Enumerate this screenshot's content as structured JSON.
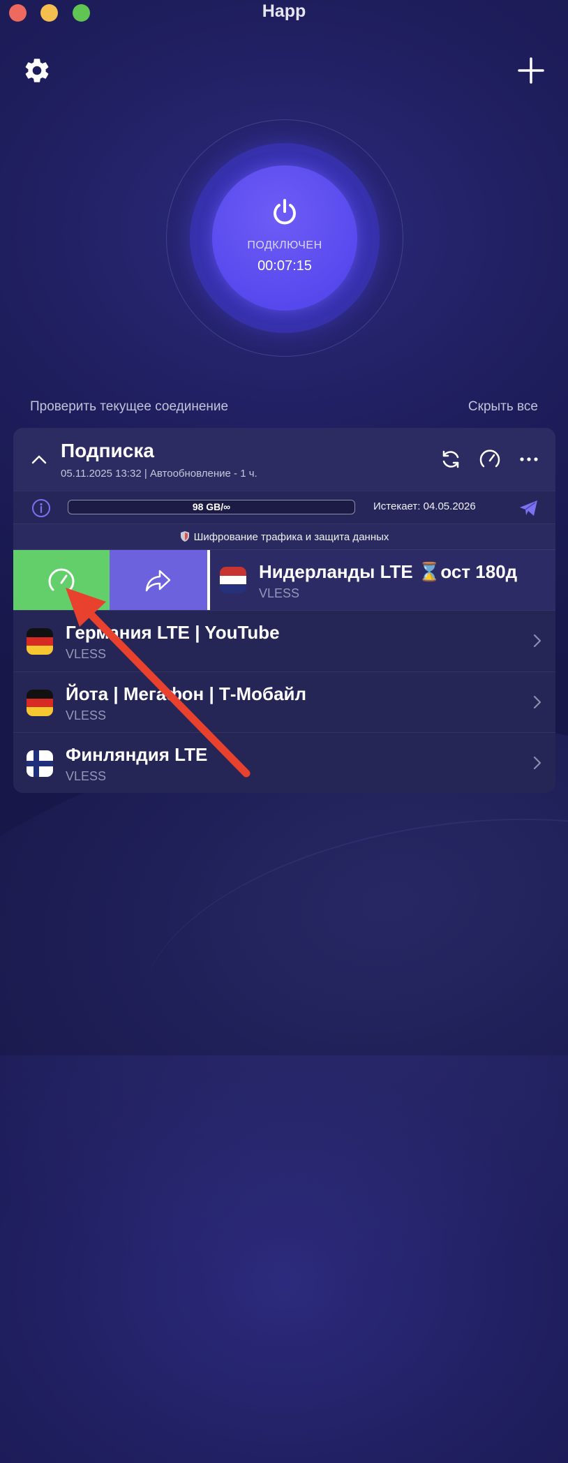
{
  "window": {
    "title": "Happ"
  },
  "header": {
    "settings_icon": "gear-icon",
    "add_icon": "plus-icon"
  },
  "connection": {
    "status": "ПОДКЛЮЧЕН",
    "timer": "00:07:15",
    "accent_color": "#5a4cef"
  },
  "links": {
    "check_connection": "Проверить текущее соединение",
    "hide_all": "Скрыть все"
  },
  "subscription": {
    "title": "Подписка",
    "updated": "05.11.2025 13:32 | Автообновление - 1 ч.",
    "quota": "98 GB/∞",
    "expires": "Истекает: 04.05.2026",
    "note": "Шифрование трафика и защита данных"
  },
  "servers": [
    {
      "name": "Нидерланды LTE ⌛ост 180д",
      "protocol": "VLESS",
      "flag": "netherlands"
    },
    {
      "name": "Германия LTE | YouTube",
      "protocol": "VLESS",
      "flag": "germany"
    },
    {
      "name": "Йота | Мегафон | Т-Мобайл",
      "protocol": "VLESS",
      "flag": "germany"
    },
    {
      "name": "Финляндия LTE",
      "protocol": "VLESS",
      "flag": "finland"
    }
  ],
  "swipe_actions": {
    "test_color": "#62cf6a",
    "share_color": "#6c62de"
  },
  "annotation_color": "#e8412e"
}
